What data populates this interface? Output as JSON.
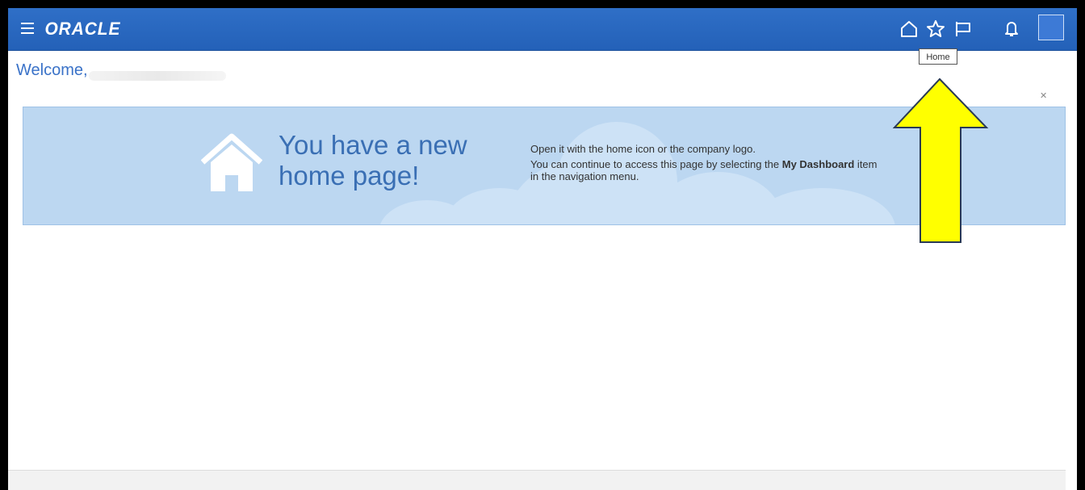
{
  "header": {
    "logo_text": "ORACLE",
    "icons": [
      "menu-icon",
      "home-icon",
      "favorites-star-icon",
      "watchlist-flag-icon",
      "notifications-bell-icon",
      "user-avatar"
    ],
    "brand_color": "#2a67bf"
  },
  "tooltip": {
    "text": "Home"
  },
  "welcome": {
    "text": "Welcome,"
  },
  "banner": {
    "headline": "You have a new home page!",
    "line1": "Open it with the home icon or the company logo.",
    "line2_prefix": "You can continue to access this page by selecting the ",
    "line2_bold": "My Dashboard",
    "line2_suffix": " item in the navigation menu.",
    "close_icon": "close-icon",
    "background_color": "#bcd7f1"
  },
  "annotation": {
    "arrow_color": "#ffff00"
  }
}
